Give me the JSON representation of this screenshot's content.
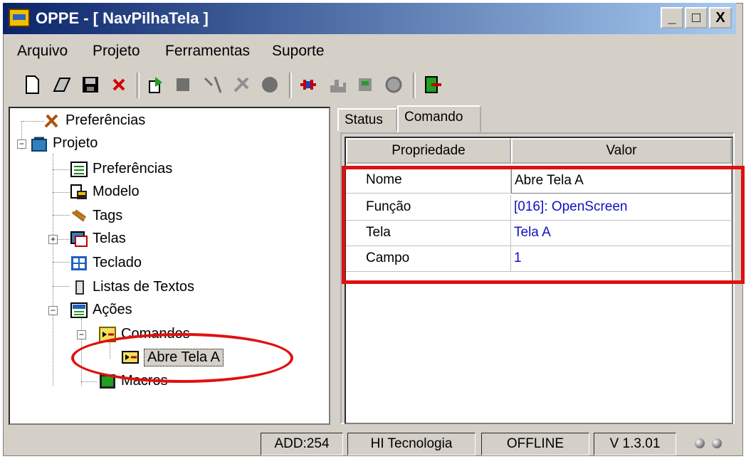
{
  "window": {
    "title": "OPPE - [ NavPilhaTela ]",
    "controls": {
      "minimize": "_",
      "maximize": "□",
      "close": "X"
    }
  },
  "menu": [
    "Arquivo",
    "Projeto",
    "Ferramentas",
    "Suporte"
  ],
  "toolbar": [
    "new-file-icon",
    "open-file-icon",
    "save-icon",
    "delete-icon",
    "import-icon",
    "compile-icon",
    "transfer-icon",
    "tool-icon",
    "record-icon",
    "connect-icon",
    "chart-icon",
    "module-icon",
    "gear-icon",
    "exit-icon"
  ],
  "tree": {
    "root_preferences": "Preferências",
    "project": "Projeto",
    "children": {
      "preferences": "Preferências",
      "model": "Modelo",
      "tags": "Tags",
      "screens": "Telas",
      "keyboard": "Teclado",
      "text_lists": "Listas de Textos",
      "actions": "Ações",
      "commands": "Comandos",
      "command_item": "Abre Tela A",
      "macros": "Macros"
    }
  },
  "tabs": {
    "status": "Status",
    "command": "Comando"
  },
  "grid": {
    "headers": {
      "property": "Propriedade",
      "value": "Valor"
    },
    "rows": [
      {
        "property": "Nome",
        "value": "Abre Tela A"
      },
      {
        "property": "Função",
        "value": "[016]: OpenScreen"
      },
      {
        "property": "Tela",
        "value": "Tela A"
      },
      {
        "property": "Campo",
        "value": "1"
      }
    ]
  },
  "status": {
    "address": "ADD:254",
    "company": "HI Tecnologia",
    "connection": "OFFLINE",
    "version": "V 1.3.01"
  },
  "colors": {
    "highlight": "#e01010",
    "value_text": "#1010c0",
    "title_start": "#0a246a"
  }
}
